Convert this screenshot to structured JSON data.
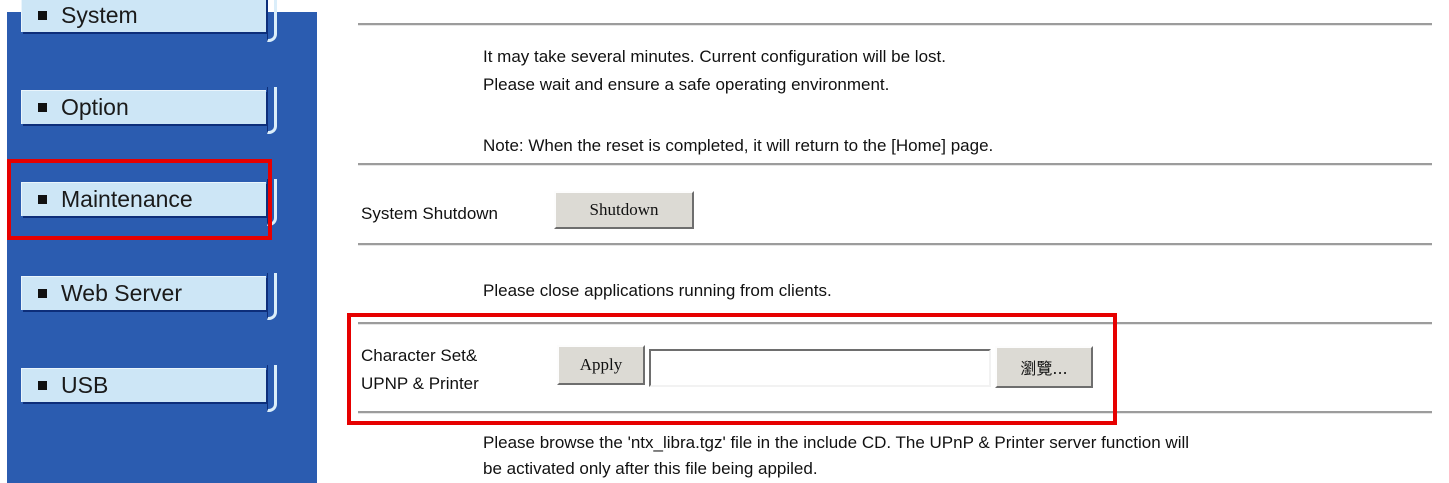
{
  "sidebar": {
    "items": [
      {
        "label": "System"
      },
      {
        "label": "Option"
      },
      {
        "label": "Maintenance"
      },
      {
        "label": "Web Server"
      },
      {
        "label": "USB"
      }
    ]
  },
  "reset": {
    "line1": "It may take several minutes. Current configuration will be lost.",
    "line2": "Please wait and ensure a safe operating environment.",
    "note": "Note: When the reset is completed, it will return to the [Home] page."
  },
  "shutdown": {
    "label": "System Shutdown",
    "button": "Shutdown",
    "hint": "Please close applications running from clients."
  },
  "charset": {
    "label_line1": "Character Set&",
    "label_line2": "UPNP & Printer",
    "apply": "Apply",
    "file_value": "",
    "browse": "瀏覽...",
    "hint_line1": "Please browse the 'ntx_libra.tgz' file in the include CD. The UPnP & Printer server function will",
    "hint_line2": "be activated only after this file being appiled."
  }
}
